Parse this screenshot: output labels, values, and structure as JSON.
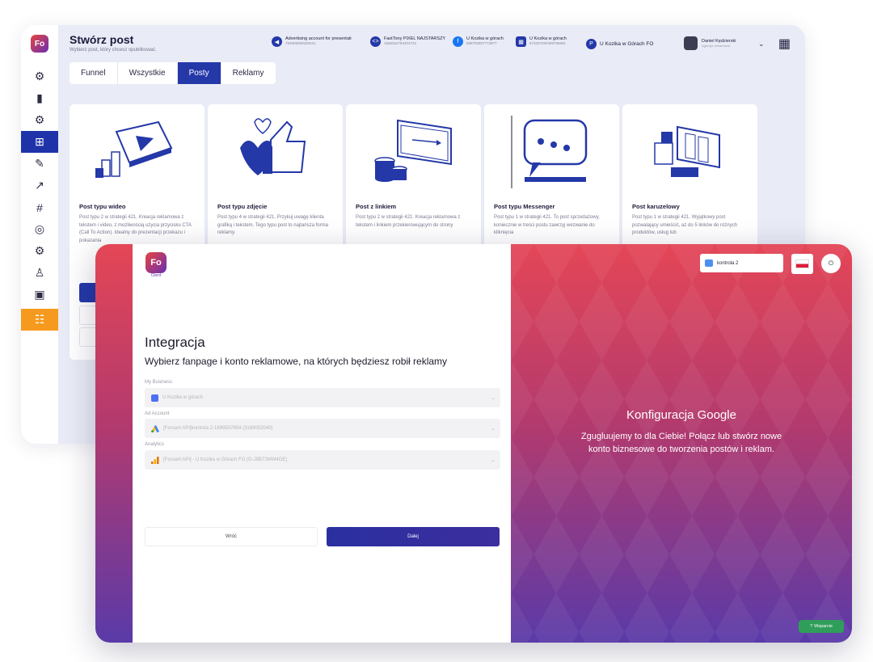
{
  "app": {
    "logo_text": "Fo",
    "logo_sub": "Client"
  },
  "header": {
    "title": "Stwórz post",
    "subtitle": "Wybierz post, który chcesz opublikować.",
    "accounts": [
      {
        "name": "Advertising account for presentati",
        "id": "794905069339421"
      },
      {
        "name": "FastTony PIXEL NAJSTARSZY",
        "id": "1558254784404722"
      },
      {
        "name": "U Kozika w górach",
        "id": "688793597773877"
      },
      {
        "name": "U Kozika w górach",
        "id": "673337920488795691"
      },
      {
        "name": "U Kozika w Górach FO",
        "id": ""
      }
    ],
    "user_name": "Daniel Kędzierski",
    "user_role": "Agencja reklamowa"
  },
  "tabs": [
    "Funnel",
    "Wszystkie",
    "Posty",
    "Reklamy"
  ],
  "cards": [
    {
      "title": "Post typu wideo",
      "desc": "Post typu 2 w strategii 421. Kreacja reklamowa z tekstem i video, z możliwością użycia przycisku CTA (Call To Action). Idealny do prezentacji przekazu i pokazania"
    },
    {
      "title": "Post typu zdjęcie",
      "desc": "Post typu 4 w strategii 421. Przykuj uwagę klienta grafiką i tekstem. Tego typu post to najtańsza forma reklamy."
    },
    {
      "title": "Post z linkiem",
      "desc": "Post typu 2 w strategii 421. Kreacja reklamowa z tekstem i linkiem przekierowującym do strony"
    },
    {
      "title": "Post typu Messenger",
      "desc": "Post typu 1 w strategii 421. To post sprzedażowy, koniecznie w treści postu zawrzyj wezwanie do kliknięcia"
    },
    {
      "title": "Post karuzelowy",
      "desc": "Post typu 1 w strategii 421. Wyjątkowy post pozwalający umieścić, aż do 5 linków do różnych produktów, usług lub"
    }
  ],
  "integration": {
    "title": "Integracja",
    "subtitle": "Wybierz fanpage i konto reklamowe, na których będziesz robił reklamy",
    "fields": [
      {
        "label": "My Business",
        "value": "U Kozika w górach"
      },
      {
        "label": "Ad Account",
        "value": "[Forsant API]kontrola 2-1699507854 (3169052040)"
      },
      {
        "label": "Analytics",
        "value": "[Forsant API] - U Kozika w Górach FO (G-J9B72MW4GE)"
      }
    ],
    "back_label": "Wróć",
    "next_label": "Dalej"
  },
  "google_panel": {
    "account": "kontrola 2",
    "title": "Konfiguracja Google",
    "desc": "Zgugluujemy to dla Ciebie! Połącz lub stwórz nowe konto biznesowe do tworzenia postów i reklam.",
    "support_label": "Wsparcie"
  },
  "colors": {
    "accent": "#2438a8",
    "sidebar_highlight": "#f59a1e",
    "gradient_top": "#e44656",
    "gradient_bottom": "#5a3aa8",
    "support": "#2f9e5a"
  }
}
